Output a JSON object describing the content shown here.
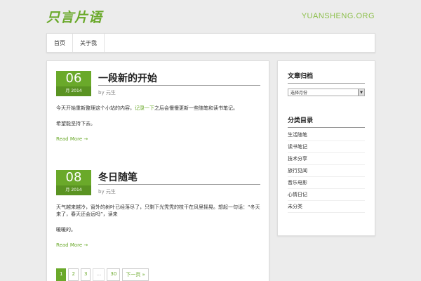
{
  "header": {
    "logo_text": "只言片语",
    "site_url": "YUANSHENG.ORG"
  },
  "nav": {
    "items": [
      {
        "label": "首页"
      },
      {
        "label": "关于我"
      }
    ]
  },
  "posts": [
    {
      "day": "06",
      "month_year": "月 2014",
      "title": "一段新的开始",
      "author_prefix": "by",
      "author": "元生",
      "body_before": "今天开始重新整理这个小站的内容，",
      "body_link": "记录一下",
      "body_after": "之后会慢慢更新一些随笔和读书笔记。",
      "body_line2": "希望能坚持下去。",
      "readmore": "Read More →"
    },
    {
      "day": "08",
      "month_year": "月 2014",
      "title": "冬日随笔",
      "author_prefix": "by",
      "author": "元生",
      "body_line1": "天气越来越冷，窗外的树叶已经落尽了，只剩下光秃秃的枝干在风里摇晃。想起一句话：“冬天来了，春天还会远吗”，读来",
      "body_line2": "暖暖的。",
      "readmore": "Read More →"
    }
  ],
  "pagination": {
    "pages": [
      "1",
      "2",
      "3",
      "…",
      "30"
    ],
    "active": "1",
    "next": "下一页 »"
  },
  "sidebar": {
    "archive_title": "文章归档",
    "archive_select_value": "选择月份",
    "category_title": "分类目录",
    "categories": [
      "生活随笔",
      "读书笔记",
      "技术分享",
      "旅行见闻",
      "音乐电影",
      "心情日记",
      "未分类"
    ]
  },
  "colors": {
    "accent": "#6aa92a",
    "background": "#ececec"
  }
}
